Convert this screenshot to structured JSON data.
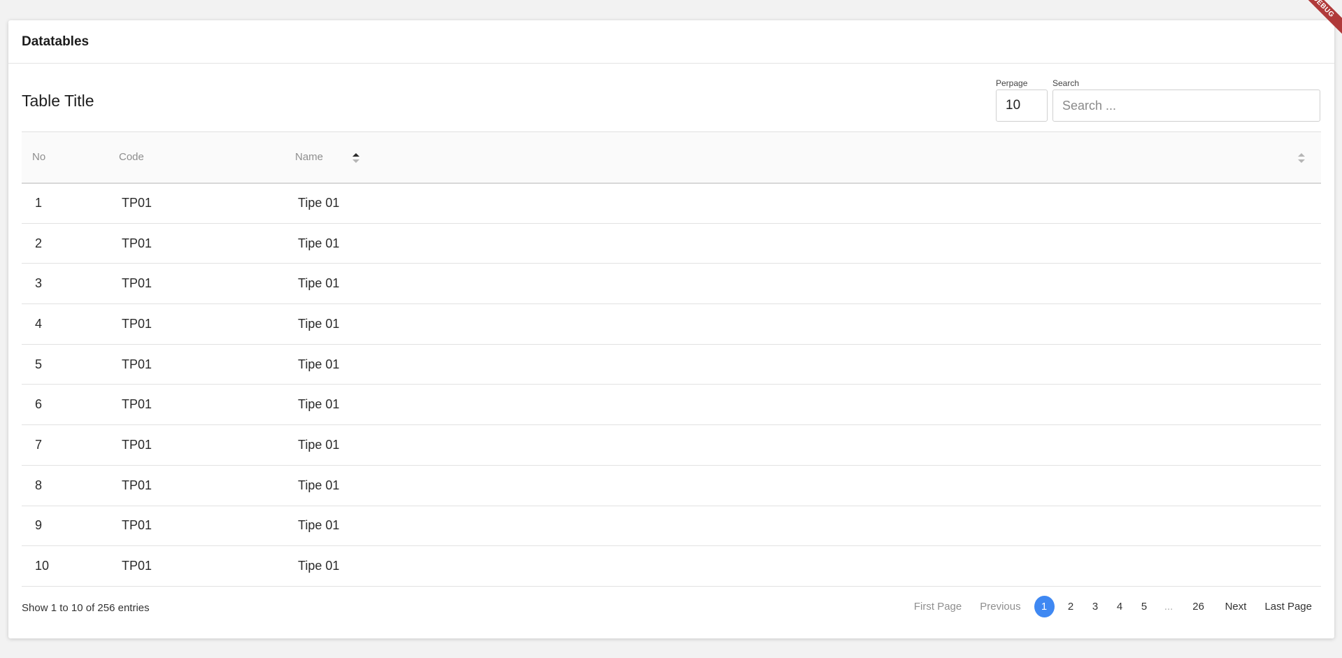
{
  "card": {
    "title": "Datatables"
  },
  "toolbar": {
    "table_title": "Table Title",
    "perpage_label": "Perpage",
    "perpage_value": "10",
    "search_label": "Search",
    "search_placeholder": "Search ..."
  },
  "table": {
    "headers": {
      "no": "No",
      "code": "Code",
      "name": "Name"
    },
    "rows": [
      {
        "no": "1",
        "code": "TP01",
        "name": "Tipe 01"
      },
      {
        "no": "2",
        "code": "TP01",
        "name": "Tipe 01"
      },
      {
        "no": "3",
        "code": "TP01",
        "name": "Tipe 01"
      },
      {
        "no": "4",
        "code": "TP01",
        "name": "Tipe 01"
      },
      {
        "no": "5",
        "code": "TP01",
        "name": "Tipe 01"
      },
      {
        "no": "6",
        "code": "TP01",
        "name": "Tipe 01"
      },
      {
        "no": "7",
        "code": "TP01",
        "name": "Tipe 01"
      },
      {
        "no": "8",
        "code": "TP01",
        "name": "Tipe 01"
      },
      {
        "no": "9",
        "code": "TP01",
        "name": "Tipe 01"
      },
      {
        "no": "10",
        "code": "TP01",
        "name": "Tipe 01"
      }
    ]
  },
  "footer": {
    "entries_info": "Show 1 to 10 of 256 entries",
    "pager": {
      "first": "First Page",
      "previous": "Previous",
      "current": "1",
      "pages": [
        "2",
        "3",
        "4",
        "5"
      ],
      "ellipsis": "...",
      "last_number": "26",
      "next": "Next",
      "last": "Last Page"
    }
  },
  "debug_banner": "DEBUG",
  "colors": {
    "accent": "#3f88f2",
    "debug": "#b03a3a"
  }
}
